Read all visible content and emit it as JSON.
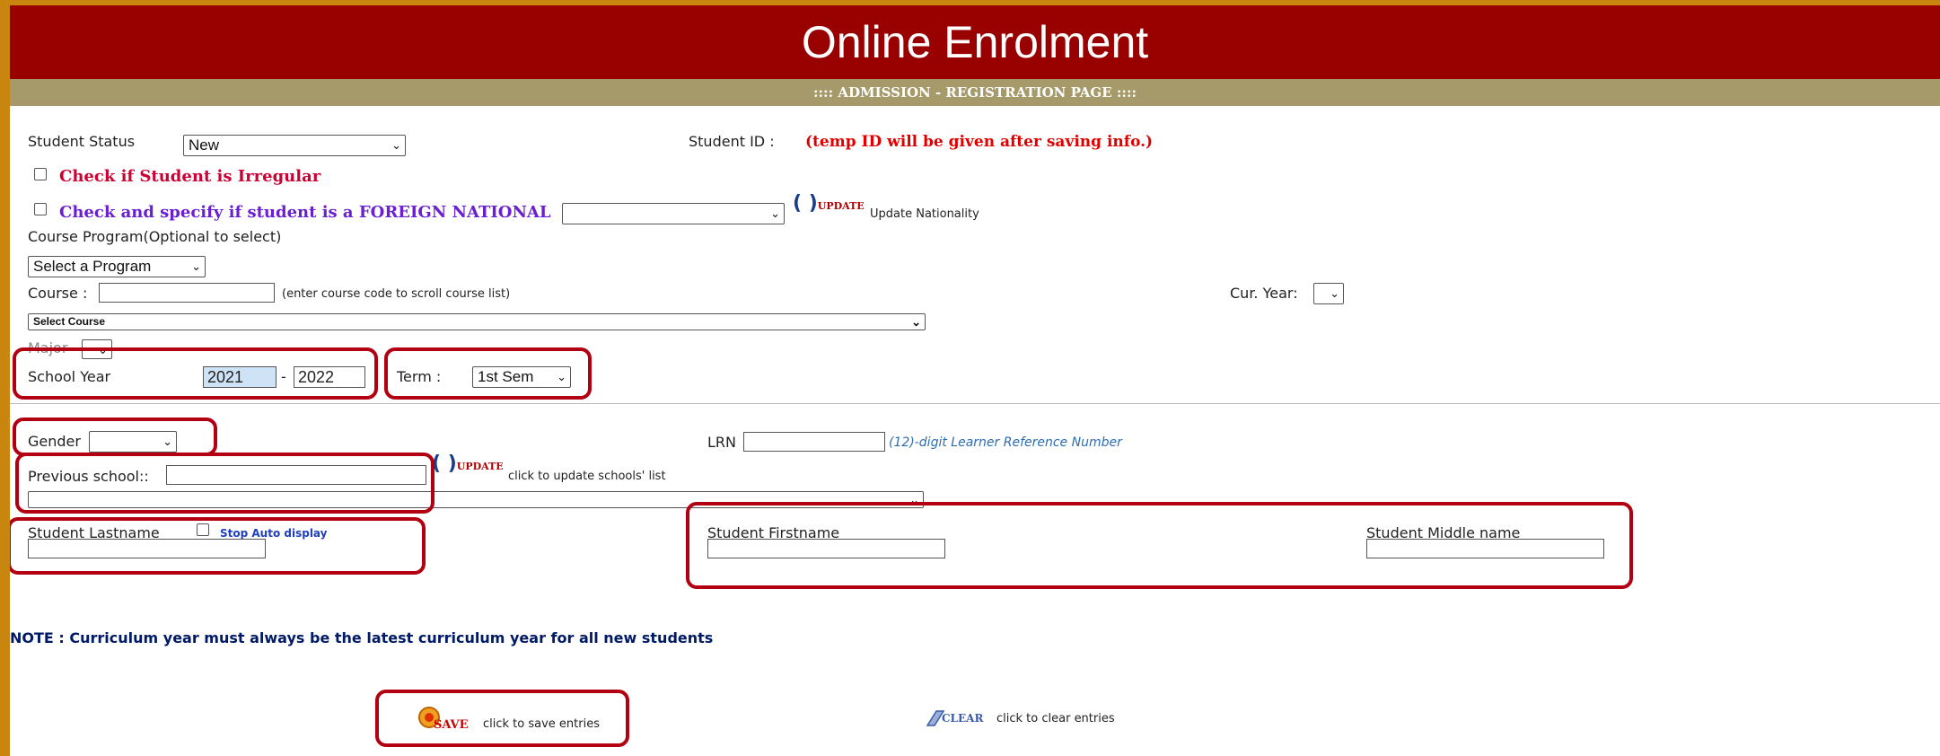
{
  "header": {
    "title": "Online Enrolment",
    "subtitle": ":::: ADMISSION - REGISTRATION PAGE ::::"
  },
  "form": {
    "student_status_label": "Student Status",
    "student_status_value": "New",
    "student_id_label": "Student ID :",
    "student_id_note": "(temp ID will be given after saving info.)",
    "irregular_label": "Check if Student is Irregular",
    "foreign_label": "Check and specify if student is a FOREIGN NATIONAL",
    "nationality_value": "",
    "update_icon_label": "UPDATE",
    "update_nationality_label": "Update Nationality",
    "course_program_label": "Course Program(Optional to select)",
    "program_value": "Select a Program",
    "course_label": "Course :",
    "course_value": "",
    "course_hint": "(enter course code to scroll course list)",
    "cur_year_label": "Cur. Year:",
    "cur_year_value": "",
    "select_course_value": "Select Course",
    "major_label": "Major",
    "major_value": "",
    "school_year_label": "School Year",
    "school_year_from": "2021",
    "school_year_sep": "-",
    "school_year_to": "2022",
    "term_label": "Term :",
    "term_value": "1st Sem",
    "gender_label": "Gender",
    "gender_value": "",
    "lrn_label": "LRN",
    "lrn_value": "",
    "lrn_hint": "(12)-digit Learner Reference Number",
    "previous_school_label": "Previous school::",
    "previous_school_value": "",
    "update_schools_label": "click to update schools' list",
    "schools_list_value": "",
    "lastname_label": "Student Lastname",
    "stop_auto_label": "Stop Auto display",
    "lastname_value": "",
    "firstname_label": "Student Firstname",
    "firstname_value": "",
    "middlename_label": "Student Middle name",
    "middlename_value": ""
  },
  "note": "NOTE : Curriculum year must always be the latest curriculum year for all new students",
  "actions": {
    "save_icon_label": "SAVE",
    "save_text": "click to save entries",
    "clear_icon_label": "CLEAR",
    "clear_text": "click to clear entries"
  },
  "colors": {
    "outer_border": "#c8860f",
    "header_bg": "#990000",
    "subheader_bg": "#a69a6a",
    "highlight_border": "#b20012",
    "alert_red": "#e00000",
    "irregular_crimson": "#cc0033",
    "foreign_purple": "#6a1fd0",
    "note_navy": "#001a66",
    "hint_blue": "#2e6db4"
  },
  "icons": [
    "refresh-update-icon",
    "save-icon",
    "clear-icon",
    "chevron-down-icon"
  ]
}
